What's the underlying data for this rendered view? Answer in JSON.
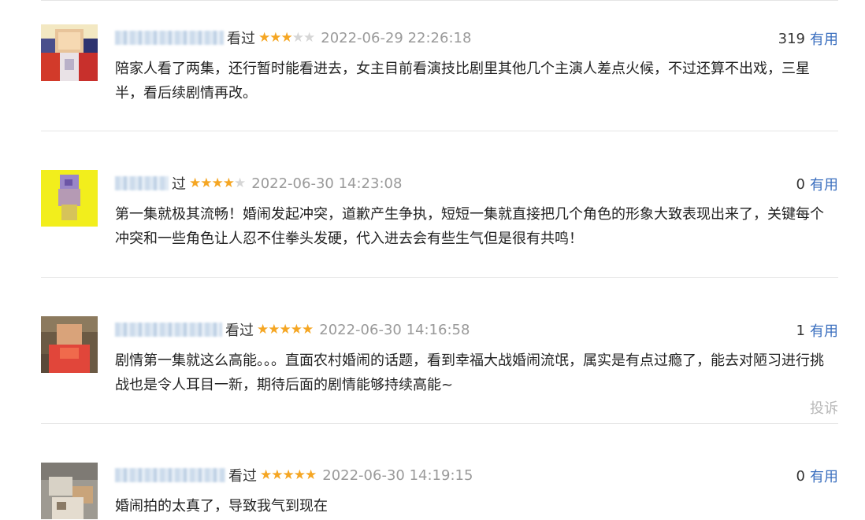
{
  "comments": [
    {
      "watched_label": "看过",
      "rating": 3,
      "max_rating": 5,
      "time": "2022-06-29 22:26:18",
      "votes": "319",
      "useful_label": "有用",
      "content": "陪家人看了两集，还行暂时能看进去，女主目前看演技比剧里其他几个主演人差点火候，不过还算不出戏，三星半，看后续剧情再改。"
    },
    {
      "watched_label": "过",
      "rating": 4,
      "max_rating": 5,
      "time": "2022-06-30 14:23:08",
      "votes": "0",
      "useful_label": "有用",
      "content": "第一集就极其流畅！婚闹发起冲突，道歉产生争执，短短一集就直接把几个角色的形象大致表现出来了，关键每个冲突和一些角色让人忍不住拳头发硬，代入进去会有些生气但是很有共鸣！"
    },
    {
      "watched_label": "看过",
      "rating": 5,
      "max_rating": 5,
      "time": "2022-06-30 14:16:58",
      "votes": "1",
      "useful_label": "有用",
      "content": "剧情第一集就这么高能。。。直面农村婚闹的话题，看到幸福大战婚闹流氓，属实是有点过瘾了，能去对陋习进行挑战也是令人耳目一新，期待后面的剧情能够持续高能~",
      "report_label": "投诉"
    },
    {
      "watched_label": "看过",
      "rating": 5,
      "max_rating": 5,
      "time": "2022-06-30 14:19:15",
      "votes": "0",
      "useful_label": "有用",
      "content": "婚闹拍的太真了，导致我气到现在"
    }
  ],
  "colors": {
    "star": "#f5a623",
    "star_empty": "#d6d6d6",
    "useful_link": "#3b6fbf",
    "timestamp": "#9a9a9a",
    "report": "#b9b9b9",
    "divider": "#e4e4e4"
  }
}
